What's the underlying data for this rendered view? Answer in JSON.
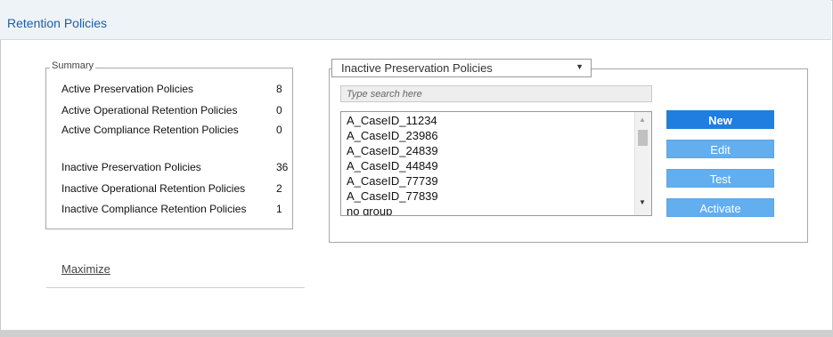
{
  "header": {
    "title": "Retention Policies"
  },
  "summary": {
    "legend": "Summary",
    "active": [
      {
        "label": "Active Preservation Policies",
        "value": "8"
      },
      {
        "label": "Active Operational Retention Policies",
        "value": "0"
      },
      {
        "label": "Active Compliance Retention Policies",
        "value": "0"
      }
    ],
    "inactive": [
      {
        "label": "Inactive Preservation Policies",
        "value": "36"
      },
      {
        "label": "Inactive Operational Retention Policies",
        "value": "2"
      },
      {
        "label": "Inactive Compliance Retention Policies",
        "value": "1"
      }
    ]
  },
  "maximize_label": "Maximize",
  "policy_panel": {
    "dropdown_selected": "Inactive Preservation Policies",
    "search_placeholder": "Type search here",
    "items": [
      "A_CaseID_11234",
      "A_CaseID_23986",
      "A_CaseID_24839",
      "A_CaseID_44849",
      "A_CaseID_77739",
      "A_CaseID_77839",
      "no group"
    ]
  },
  "buttons": {
    "new": "New",
    "edit": "Edit",
    "test": "Test",
    "activate": "Activate"
  },
  "colors": {
    "primary_button": "#1f7ee0",
    "secondary_button": "#62aeee",
    "header_bg": "#eef3f8",
    "title": "#1f5fa0"
  }
}
